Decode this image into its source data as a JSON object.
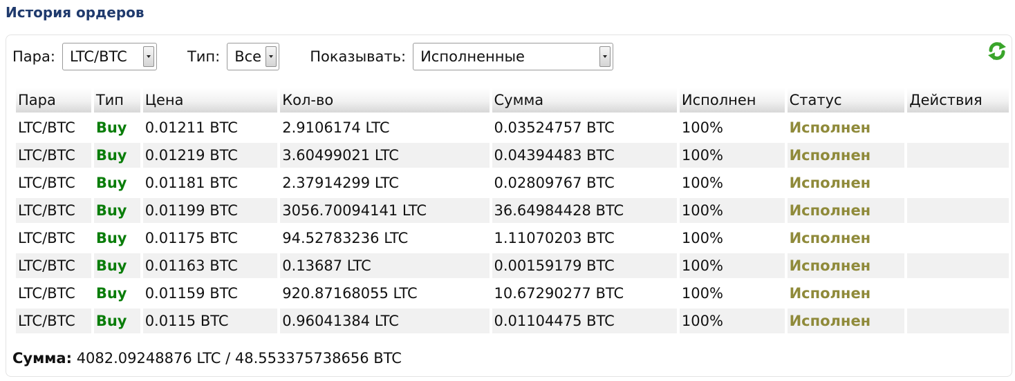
{
  "page": {
    "title": "История ордеров"
  },
  "filters": {
    "pair_label": "Пара:",
    "pair_value": "LTC/BTC",
    "type_label": "Тип:",
    "type_value": "Все",
    "show_label": "Показывать:",
    "show_value": "Исполненные"
  },
  "icons": {
    "refresh": "refresh-icon",
    "refresh_color": "#3aa52b"
  },
  "table": {
    "headers": [
      "Пара",
      "Тип",
      "Цена",
      "Кол-во",
      "Сумма",
      "Исполнен",
      "Статус",
      "Действия"
    ],
    "rows": [
      {
        "pair": "LTC/BTC",
        "type": "Buy",
        "price": "0.01211 BTC",
        "amount": "2.9106174 LTC",
        "total": "0.03524757 BTC",
        "filled": "100%",
        "status": "Исполнен",
        "actions": ""
      },
      {
        "pair": "LTC/BTC",
        "type": "Buy",
        "price": "0.01219 BTC",
        "amount": "3.60499021 LTC",
        "total": "0.04394483 BTC",
        "filled": "100%",
        "status": "Исполнен",
        "actions": ""
      },
      {
        "pair": "LTC/BTC",
        "type": "Buy",
        "price": "0.01181 BTC",
        "amount": "2.37914299 LTC",
        "total": "0.02809767 BTC",
        "filled": "100%",
        "status": "Исполнен",
        "actions": ""
      },
      {
        "pair": "LTC/BTC",
        "type": "Buy",
        "price": "0.01199 BTC",
        "amount": "3056.70094141 LTC",
        "total": "36.64984428 BTC",
        "filled": "100%",
        "status": "Исполнен",
        "actions": ""
      },
      {
        "pair": "LTC/BTC",
        "type": "Buy",
        "price": "0.01175 BTC",
        "amount": "94.52783236 LTC",
        "total": "1.11070203 BTC",
        "filled": "100%",
        "status": "Исполнен",
        "actions": ""
      },
      {
        "pair": "LTC/BTC",
        "type": "Buy",
        "price": "0.01163 BTC",
        "amount": "0.13687 LTC",
        "total": "0.00159179 BTC",
        "filled": "100%",
        "status": "Исполнен",
        "actions": ""
      },
      {
        "pair": "LTC/BTC",
        "type": "Buy",
        "price": "0.01159 BTC",
        "amount": "920.87168055 LTC",
        "total": "10.67290277 BTC",
        "filled": "100%",
        "status": "Исполнен",
        "actions": ""
      },
      {
        "pair": "LTC/BTC",
        "type": "Buy",
        "price": "0.0115 BTC",
        "amount": "0.96041384 LTC",
        "total": "0.01104475 BTC",
        "filled": "100%",
        "status": "Исполнен",
        "actions": ""
      }
    ]
  },
  "summary": {
    "label": "Сумма:",
    "value": "4082.09248876 LTC / 48.553375738656 BTC"
  },
  "colors": {
    "title": "#1f3a6d",
    "buy": "#0a7d0a",
    "status_done": "#8f8a3a",
    "row_alt": "#f1f1f1"
  }
}
